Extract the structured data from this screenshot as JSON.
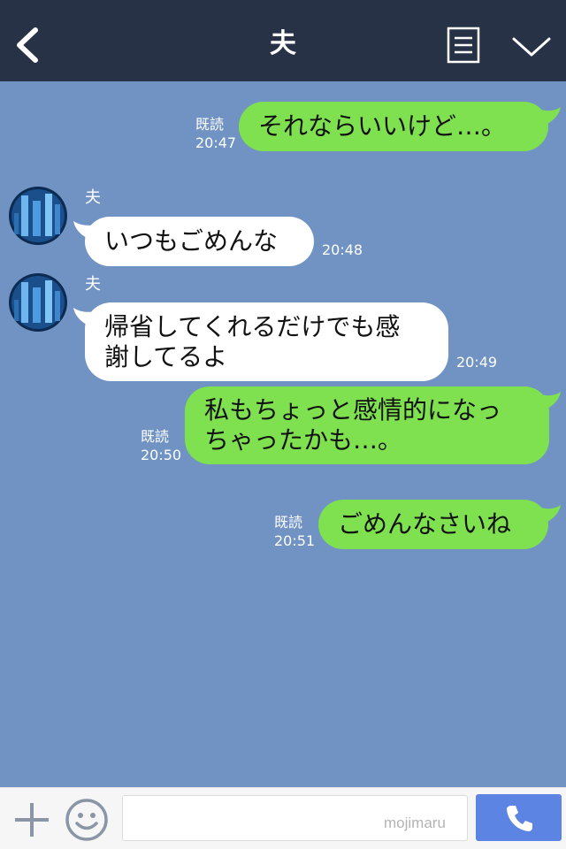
{
  "header": {
    "title": "夫",
    "back_icon": "chevron-left-icon",
    "notes_icon": "note-list-icon",
    "menu_icon": "chevron-down-icon"
  },
  "messages": [
    {
      "direction": "out",
      "text": "それならいいけど…。",
      "read_label": "既読",
      "time": "20:47"
    },
    {
      "direction": "in",
      "sender": "夫",
      "text": "いつもごめんな",
      "time": "20:48"
    },
    {
      "direction": "in",
      "sender": "夫",
      "text_lines": [
        "帰省してくれるだけでも感",
        "謝してるよ"
      ],
      "time": "20:49"
    },
    {
      "direction": "out",
      "text_lines": [
        "私もちょっと感情的になっ",
        "ちゃったかも…。"
      ],
      "read_label": "既読",
      "time": "20:50"
    },
    {
      "direction": "out",
      "text": "ごめんなさいね",
      "read_label": "既読",
      "time": "20:51"
    }
  ],
  "input_bar": {
    "plus_icon": "plus-icon",
    "emoji_icon": "smiley-icon",
    "message_value": "",
    "call_icon": "phone-icon"
  },
  "watermark": "mojimaru",
  "colors": {
    "header_bg": "#273246",
    "chat_bg": "#7093c3",
    "outgoing_bubble": "#7fe050",
    "incoming_bubble": "#ffffff",
    "call_button": "#5b84e3"
  }
}
